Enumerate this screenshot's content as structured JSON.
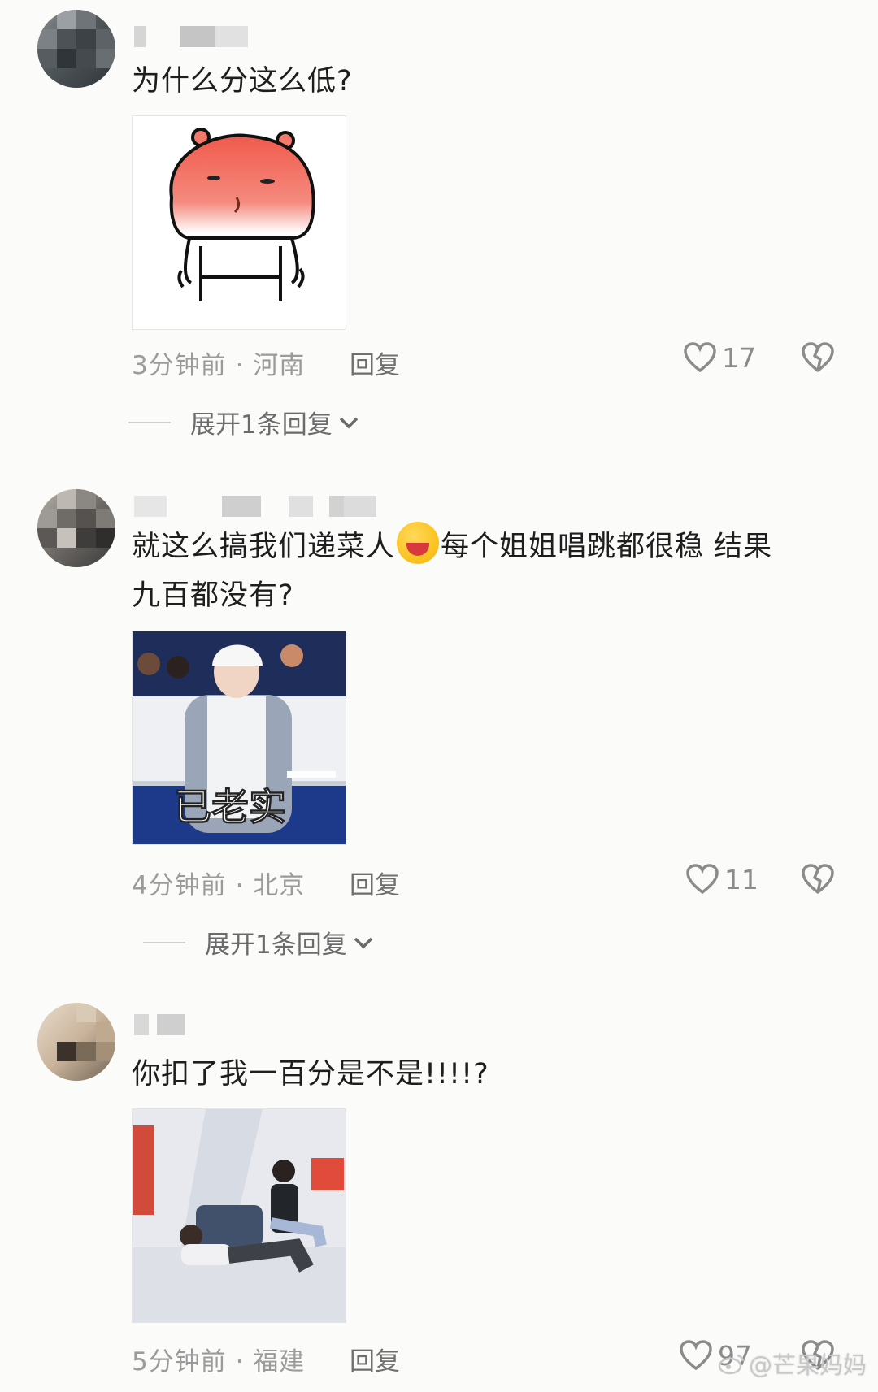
{
  "comments": [
    {
      "text": "为什么分这么低?",
      "time": "3分钟前 · 河南",
      "reply": "回复",
      "likes": "17",
      "expand": "展开1条回复"
    },
    {
      "text_a": "就这么搞我们递菜人",
      "text_b": "每个姐姐唱跳都很稳 结果",
      "text_c": "九百都没有?",
      "time": "4分钟前 · 北京",
      "reply": "回复",
      "likes": "11",
      "expand": "展开1条回复",
      "image_caption": "已老实"
    },
    {
      "text": "你扣了我一百分是不是!!!!?",
      "time": "5分钟前 · 福建",
      "reply": "回复",
      "likes": "97"
    }
  ],
  "watermark": "@芒果妈妈",
  "icons": {
    "like": "heart-outline-icon",
    "dislike": "broken-heart-icon",
    "expand": "chevron-down-icon"
  }
}
